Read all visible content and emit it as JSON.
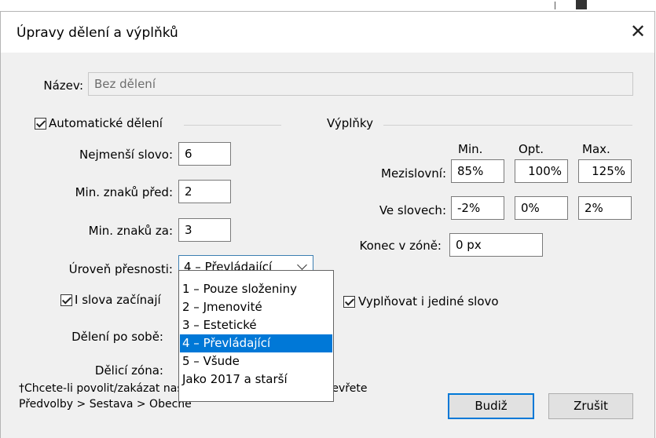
{
  "title": "Úpravy dělení a výplňků",
  "name_label": "Název:",
  "name_value": "Bez dělení",
  "hyphenation": {
    "auto_label": "Automatické dělení",
    "auto_checked": true,
    "smallest_word_label": "Nejmenší slovo:",
    "smallest_word": "6",
    "min_before_label": "Min. znaků před:",
    "min_before": "2",
    "min_after_label": "Min. znaků za:",
    "min_after": "3",
    "accuracy_label": "Úroveň přesnosti:",
    "accuracy_value": "4 – Převládající",
    "accuracy_options": [
      "1 – Pouze složeniny",
      "2 – Jmenovité",
      "3 – Estetické",
      "4 – Převládající",
      "5 – Všude",
      "Jako 2017 a starší"
    ],
    "accuracy_selected_index": 3,
    "capitalized_label": "I slova začínají",
    "capitalized_checked": true,
    "consecutive_label": "Dělení po sobě:",
    "zone_label": "Dělicí zóna:"
  },
  "justification": {
    "section_label": "Výplňky",
    "col_min": "Min.",
    "col_opt": "Opt.",
    "col_max": "Max.",
    "word_spacing_label": "Mezislovní:",
    "word_spacing": [
      "85%",
      "100%",
      "125%"
    ],
    "letter_spacing_label": "Ve slovech:",
    "letter_spacing": [
      "-2%",
      "0%",
      "2%"
    ],
    "flush_zone_label": "Konec v zóně:",
    "flush_zone": "0 px",
    "single_word_label": "Vyplňovat i jediné slovo",
    "single_word_checked": true
  },
  "note_line1": "†Chcete-li povolit/zakázat nastavení pro zarovnání EA, otevřete",
  "note_line2": "Předvolby > Sestava > Obecné",
  "ok_label": "Budiž",
  "cancel_label": "Zrušit"
}
